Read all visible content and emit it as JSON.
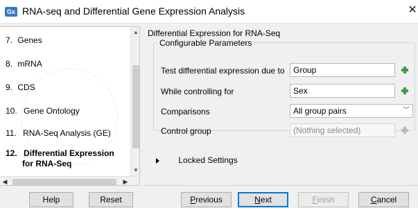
{
  "window": {
    "app_icon": "Gx",
    "title": "RNA-seq and Differential Gene Expression Analysis",
    "close_label": "✕"
  },
  "steps": [
    {
      "num": "7.",
      "label": "Genes"
    },
    {
      "num": "8.",
      "label": "mRNA"
    },
    {
      "num": "9.",
      "label": "CDS"
    },
    {
      "num": "10.",
      "label": "Gene Ontology"
    },
    {
      "num": "11.",
      "label": "RNA-Seq Analysis (GE)"
    },
    {
      "num": "12.",
      "label": "Differential Expression",
      "label2": "for RNA-Seq",
      "active": true
    }
  ],
  "panel": {
    "title": "Differential Expression for RNA-Seq",
    "group_title": "Configurable Parameters",
    "params": [
      {
        "label": "Test differential expression due to",
        "value": "Group"
      },
      {
        "label": "While controlling for",
        "value": "Sex"
      },
      {
        "label": "Comparisons",
        "value": "All group pairs"
      },
      {
        "label": "Control group",
        "placeholder": "(Nothing selected)"
      }
    ],
    "locked_label": "Locked Settings"
  },
  "buttons": {
    "help": "Help",
    "reset": "Reset",
    "previous_u": "P",
    "previous_rest": "revious",
    "next_u": "N",
    "next_rest": "ext",
    "finish_u": "F",
    "finish_rest": "inish",
    "cancel_u": "C",
    "cancel_rest": "ancel"
  },
  "colors": {
    "accent": "#0078d7",
    "add_icon": "#3f9a3f",
    "app_icon_bg": "#3a78c2"
  },
  "icons": {
    "add": "plus-icon",
    "dropdown": "chevron-down-icon",
    "expand": "triangle-right-icon"
  }
}
